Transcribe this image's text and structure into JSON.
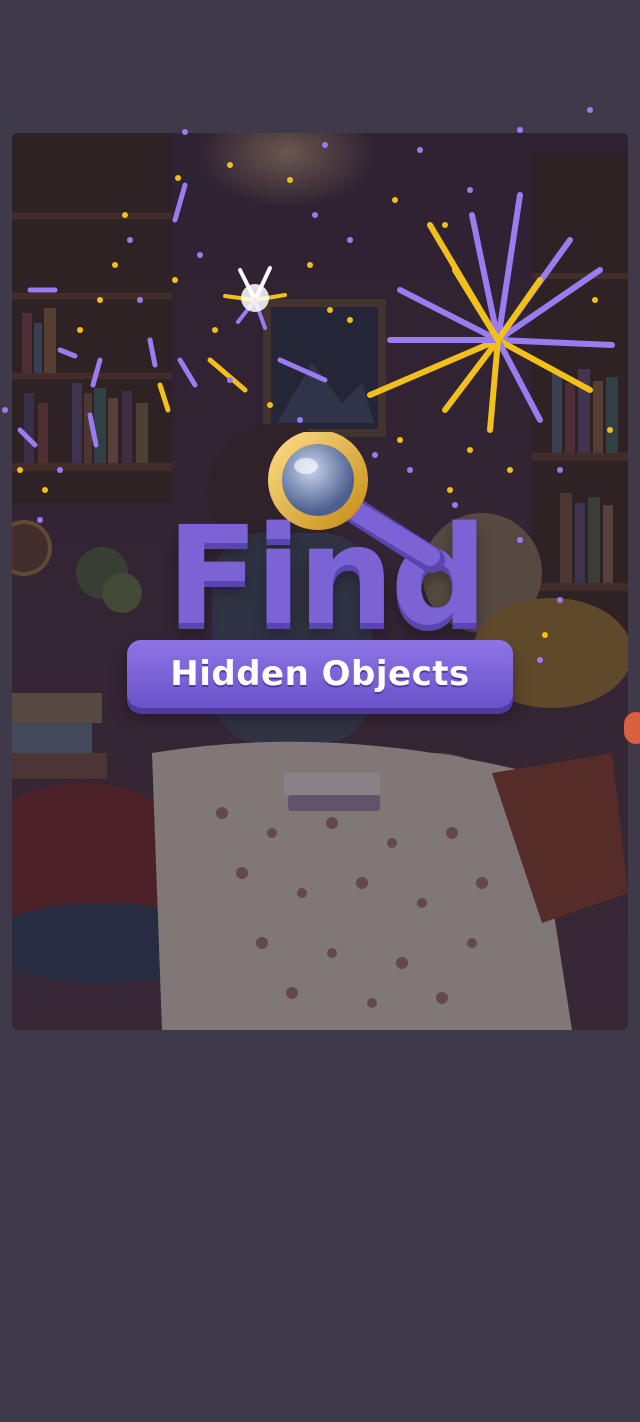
{
  "screen": {
    "background_color": "#3f3a4a"
  },
  "logo": {
    "title": "Find",
    "subtitle": "Hidden Objects",
    "title_color": "#7b63d6",
    "banner_color": "#7b63d6"
  },
  "scene": {
    "illustration": "cozy-bedroom-with-bookshelves",
    "overlay": "dim"
  },
  "effects": {
    "fireworks_colors": [
      "#9a7cf0",
      "#f2c01b",
      "#ffffff"
    ]
  }
}
